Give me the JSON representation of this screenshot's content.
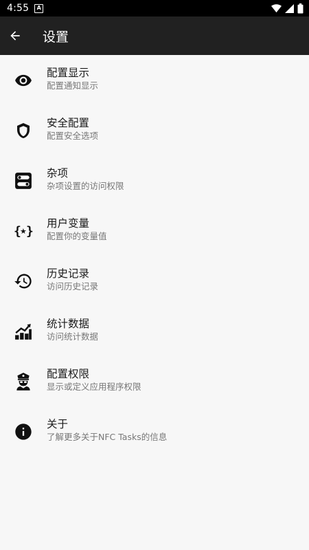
{
  "status_bar": {
    "time": "4:55",
    "notif_glyph": "A"
  },
  "app_bar": {
    "title": "设置",
    "back_icon": "arrow-back-icon"
  },
  "items": [
    {
      "title": "配置显示",
      "subtitle": "配置通知显示",
      "icon": "eye-icon"
    },
    {
      "title": "安全配置",
      "subtitle": "配置安全选项",
      "icon": "shield-icon"
    },
    {
      "title": "杂项",
      "subtitle": "杂项设置的访问权限",
      "icon": "toggle-switches-icon"
    },
    {
      "title": "用户变量",
      "subtitle": "配置你的变量值",
      "icon": "variable-braces-icon"
    },
    {
      "title": "历史记录",
      "subtitle": "访问历史记录",
      "icon": "history-icon"
    },
    {
      "title": "统计数据",
      "subtitle": "访问统计数据",
      "icon": "chart-icon"
    },
    {
      "title": "配置权限",
      "subtitle": "显示或定义应用程序权限",
      "icon": "police-officer-icon"
    },
    {
      "title": "关于",
      "subtitle": "了解更多关于NFC Tasks的信息",
      "icon": "info-icon"
    }
  ]
}
